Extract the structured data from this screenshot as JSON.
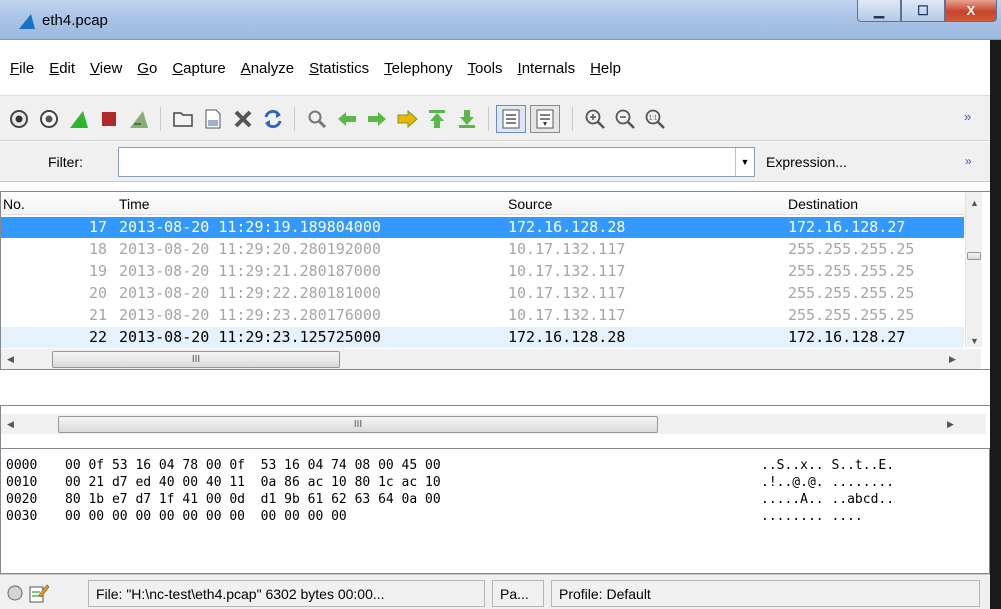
{
  "window": {
    "title": "eth4.pcap",
    "minimize_label": "▁",
    "maximize_label": "☐",
    "close_label": "X"
  },
  "menu": [
    "File",
    "Edit",
    "View",
    "Go",
    "Capture",
    "Analyze",
    "Statistics",
    "Telephony",
    "Tools",
    "Internals",
    "Help"
  ],
  "toolbar": {
    "icons": [
      "interfaces-icon",
      "options-icon",
      "start-capture-icon",
      "stop-capture-icon",
      "restart-capture-icon",
      "open-file-icon",
      "save-file-icon",
      "close-file-icon",
      "reload-icon",
      "find-icon",
      "back-icon",
      "forward-icon",
      "go-to-packet-icon",
      "first-packet-icon",
      "last-packet-icon",
      "colorize-icon",
      "auto-scroll-icon",
      "zoom-in-icon",
      "zoom-out-icon",
      "normal-size-icon"
    ],
    "more_label": "»"
  },
  "filter": {
    "label": "Filter:",
    "value": "",
    "expression_label": "Expression...",
    "more_label": "»"
  },
  "packet_list": {
    "columns": [
      "No.",
      "Time",
      "Source",
      "Destination"
    ],
    "rows": [
      {
        "no": "17",
        "time": "2013-08-20 11:29:19.189804000",
        "source": "172.16.128.28",
        "destination": "172.16.128.27",
        "state": "selected"
      },
      {
        "no": "18",
        "time": "2013-08-20 11:29:20.280192000",
        "source": "10.17.132.117",
        "destination": "255.255.255.25",
        "state": "dim"
      },
      {
        "no": "19",
        "time": "2013-08-20 11:29:21.280187000",
        "source": "10.17.132.117",
        "destination": "255.255.255.25",
        "state": "dim"
      },
      {
        "no": "20",
        "time": "2013-08-20 11:29:22.280181000",
        "source": "10.17.132.117",
        "destination": "255.255.255.25",
        "state": "dim"
      },
      {
        "no": "21",
        "time": "2013-08-20 11:29:23.280176000",
        "source": "10.17.132.117",
        "destination": "255.255.255.25",
        "state": "dim"
      },
      {
        "no": "22",
        "time": "2013-08-20 11:29:23.125725000",
        "source": "172.16.128.28",
        "destination": "172.16.128.27",
        "state": "highlight"
      }
    ],
    "hscroll_thumb_label": "III"
  },
  "detail": {
    "hscroll_thumb_label": "III"
  },
  "hex": {
    "rows": [
      {
        "offset": "0000",
        "bytes": "00 0f 53 16 04 78 00 0f  53 16 04 74 08 00 45 00",
        "ascii": "..S..x.. S..t..E."
      },
      {
        "offset": "0010",
        "bytes": "00 21 d7 ed 40 00 40 11  0a 86 ac 10 80 1c ac 10",
        "ascii": ".!..@.@. ........"
      },
      {
        "offset": "0020",
        "bytes": "80 1b e7 d7 1f 41 00 0d  d1 9b 61 62 63 64 0a 00",
        "ascii": ".....A.. ..abcd.."
      },
      {
        "offset": "0030",
        "bytes": "00 00 00 00 00 00 00 00  00 00 00 00",
        "ascii": "........ ...."
      }
    ]
  },
  "status": {
    "file": "File: \"H:\\nc-test\\eth4.pcap\" 6302 bytes 00:00...",
    "packets": "Pa...",
    "profile": "Profile: Default"
  }
}
